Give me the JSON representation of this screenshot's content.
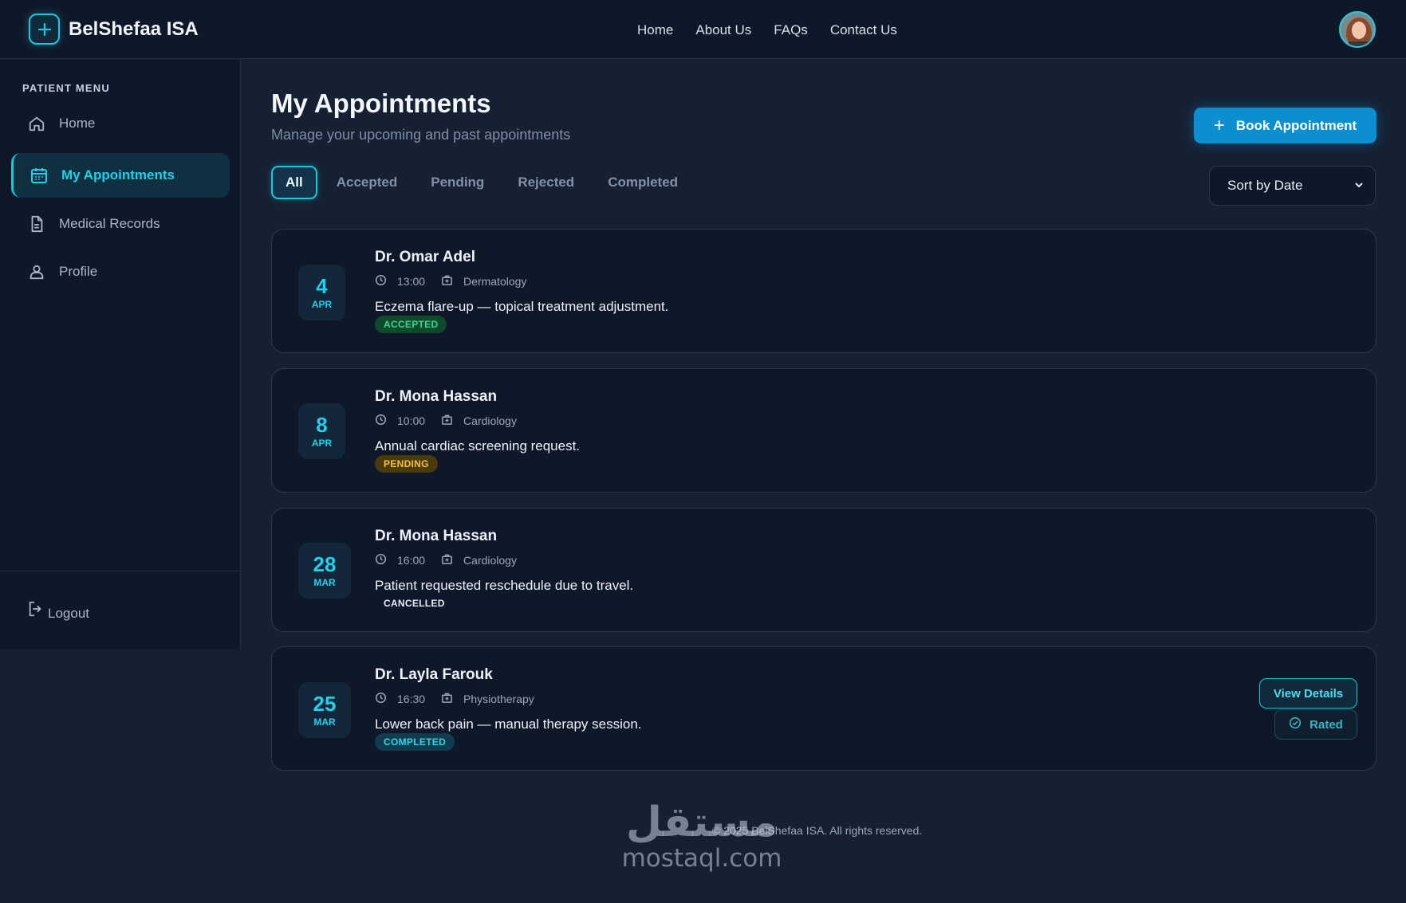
{
  "app": {
    "brand": "BelShefaa ISA",
    "colors": {
      "accent": "#1fc7dd",
      "primary_button": "#0b8fd0",
      "background": "#162033",
      "panel": "#0f1829"
    }
  },
  "topnav": {
    "items": [
      "Home",
      "About Us",
      "FAQs",
      "Contact Us"
    ]
  },
  "sidebar": {
    "heading": "PATIENT MENU",
    "items": [
      {
        "label": "Home",
        "icon": "home-icon"
      },
      {
        "label": "My Appointments",
        "icon": "calendar-icon",
        "active": true
      },
      {
        "label": "Medical Records",
        "icon": "document-icon"
      },
      {
        "label": "Profile",
        "icon": "user-icon"
      }
    ],
    "logout": "Logout"
  },
  "main": {
    "title": "My Appointments",
    "subtitle": "Manage your upcoming and past appointments",
    "book_button": "Book Appointment",
    "tabs": [
      "All",
      "Accepted",
      "Pending",
      "Rejected",
      "Completed"
    ],
    "active_tab": "All",
    "sort": {
      "selected": "Sort by Date"
    }
  },
  "appointments": [
    {
      "day": "4",
      "month": "APR",
      "doctor": "Dr. Omar Adel",
      "time": "13:00",
      "specialty": "Dermatology",
      "note": "Eczema flare-up — topical treatment adjustment.",
      "status": "ACCEPTED"
    },
    {
      "day": "8",
      "month": "APR",
      "doctor": "Dr. Mona Hassan",
      "time": "10:00",
      "specialty": "Cardiology",
      "note": "Annual cardiac screening request.",
      "status": "PENDING"
    },
    {
      "day": "28",
      "month": "MAR",
      "doctor": "Dr. Mona Hassan",
      "time": "16:00",
      "specialty": "Cardiology",
      "note": "Patient requested reschedule due to travel.",
      "status": "CANCELLED"
    },
    {
      "day": "25",
      "month": "MAR",
      "doctor": "Dr. Layla Farouk",
      "time": "16:30",
      "specialty": "Physiotherapy",
      "note": "Lower back pain — manual therapy session.",
      "status": "COMPLETED",
      "actions": {
        "view": "View Details",
        "rated": "Rated"
      }
    }
  ],
  "footer": "© 2025 BelShefaa ISA. All rights reserved.",
  "watermark": {
    "arabic": "مستقل",
    "latin": "mostaql.com"
  }
}
